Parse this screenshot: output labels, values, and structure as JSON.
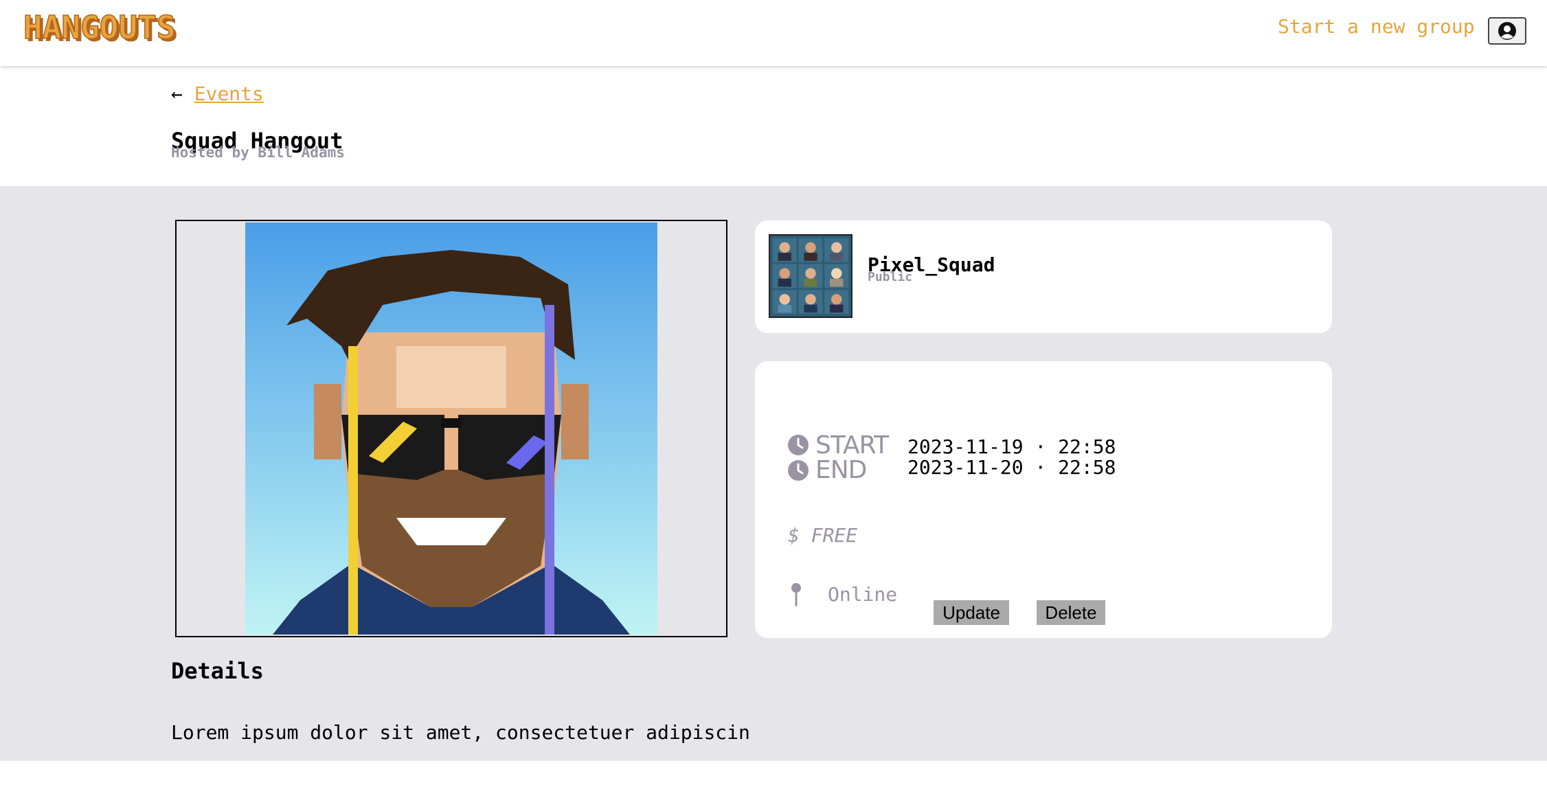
{
  "header": {
    "logo_text": "HANGOUTS",
    "new_group_label": "Start a new group",
    "brand_color": "#e8a43c",
    "profile_icon": "user-circle-icon"
  },
  "breadcrumb": {
    "arrow": "←",
    "link_label": "Events"
  },
  "event": {
    "title": "Squad Hangout",
    "host_line": "Hosted by Bill Adams",
    "start_label": "START",
    "end_label": "END",
    "start_value": "2023-11-19 · 22:58",
    "end_value": "2023-11-20 · 22:58",
    "price": "$ FREE",
    "location": "Online",
    "clock_icon": "clock-icon",
    "pin_icon": "map-pin-icon"
  },
  "group": {
    "name": "Pixel_Squad",
    "visibility": "Public"
  },
  "actions": {
    "update_label": "Update",
    "delete_label": "Delete"
  },
  "details": {
    "heading": "Details",
    "text": "Lorem ipsum dolor sit amet, consectetuer adipiscin"
  }
}
